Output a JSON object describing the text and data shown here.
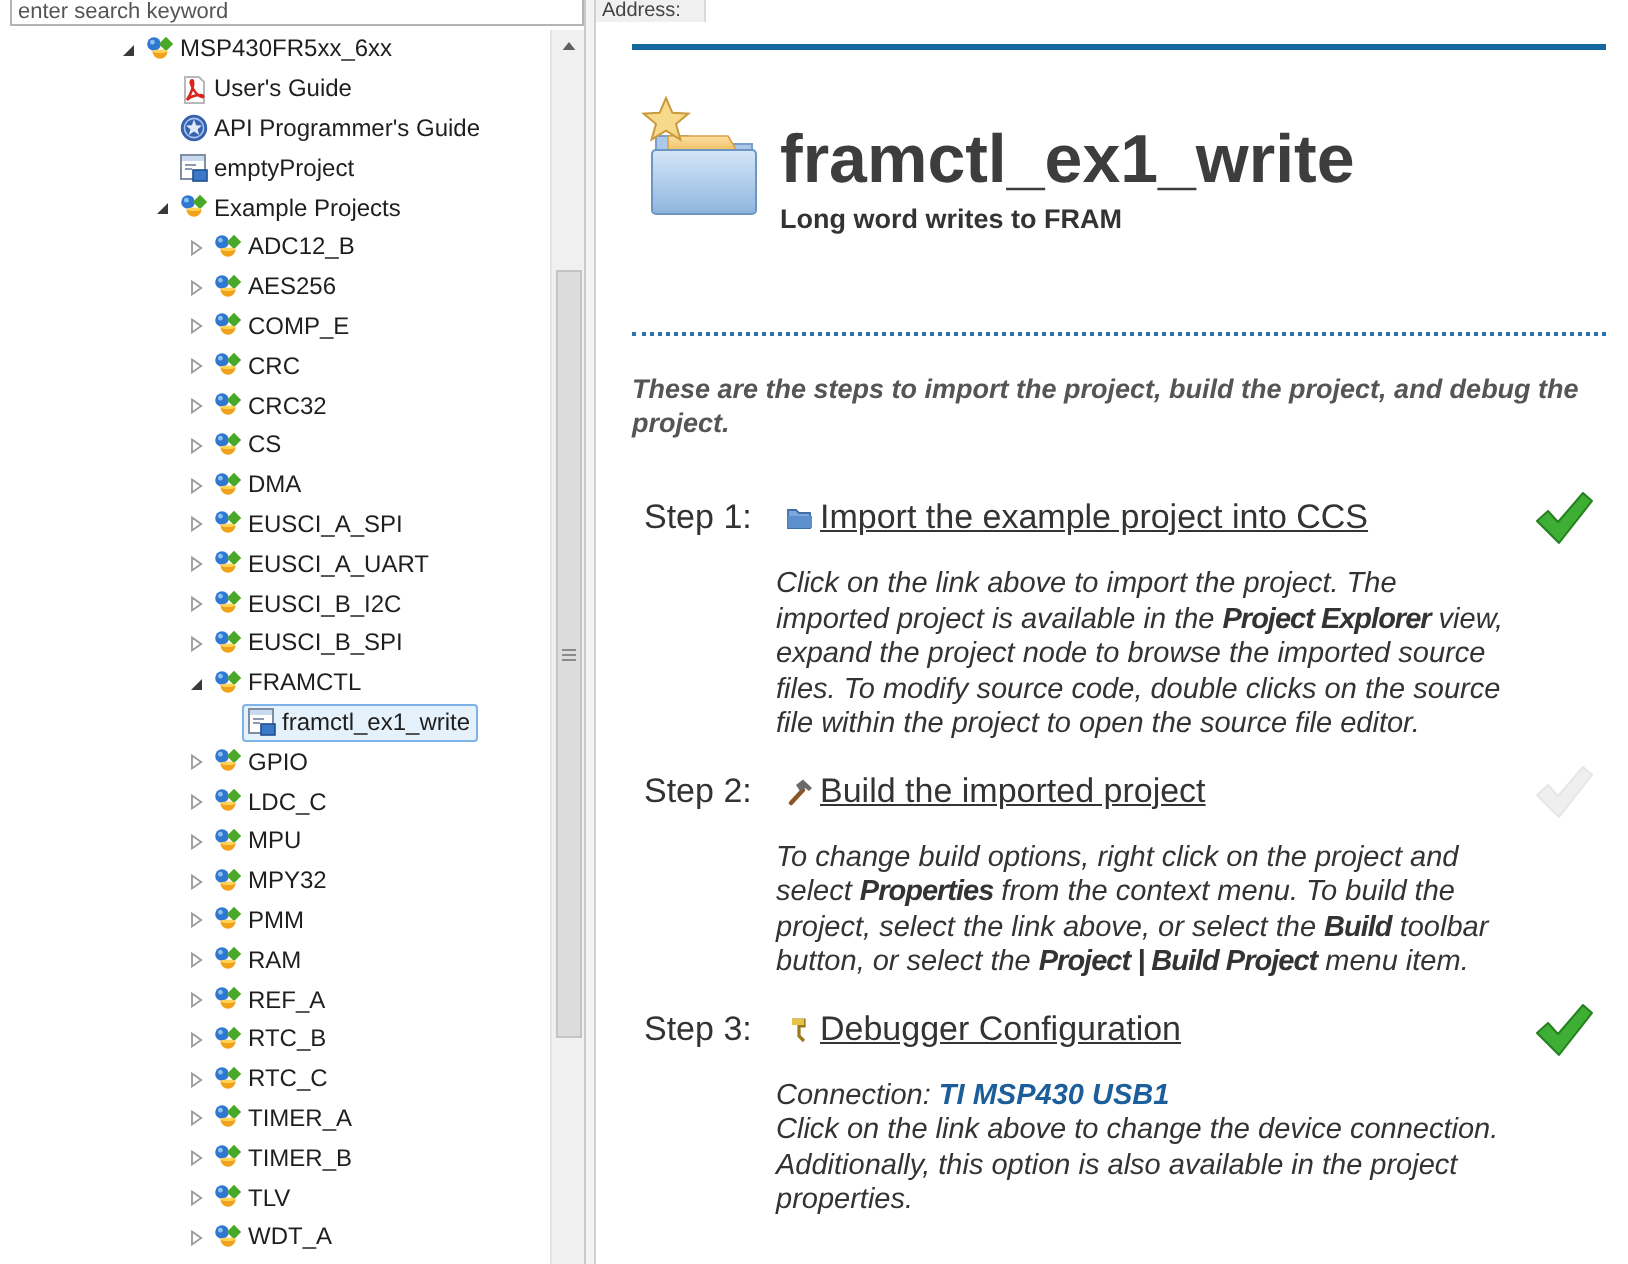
{
  "search": {
    "placeholder": "enter search keyword"
  },
  "tree": {
    "items": [
      {
        "label": "MSP430FR5xx_6xx",
        "kind": "package",
        "expanded": true,
        "selected": false,
        "children": [
          {
            "label": "User's Guide",
            "kind": "pdf",
            "selected": false
          },
          {
            "label": "API Programmer's Guide",
            "kind": "api",
            "selected": false
          },
          {
            "label": "emptyProject",
            "kind": "project",
            "selected": false
          },
          {
            "label": "Example Projects",
            "kind": "package",
            "expanded": true,
            "selected": false,
            "children": [
              {
                "label": "ADC12_B",
                "kind": "package",
                "expanded": false,
                "selected": false
              },
              {
                "label": "AES256",
                "kind": "package",
                "expanded": false,
                "selected": false
              },
              {
                "label": "COMP_E",
                "kind": "package",
                "expanded": false,
                "selected": false
              },
              {
                "label": "CRC",
                "kind": "package",
                "expanded": false,
                "selected": false
              },
              {
                "label": "CRC32",
                "kind": "package",
                "expanded": false,
                "selected": false
              },
              {
                "label": "CS",
                "kind": "package",
                "expanded": false,
                "selected": false
              },
              {
                "label": "DMA",
                "kind": "package",
                "expanded": false,
                "selected": false
              },
              {
                "label": "EUSCI_A_SPI",
                "kind": "package",
                "expanded": false,
                "selected": false
              },
              {
                "label": "EUSCI_A_UART",
                "kind": "package",
                "expanded": false,
                "selected": false
              },
              {
                "label": "EUSCI_B_I2C",
                "kind": "package",
                "expanded": false,
                "selected": false
              },
              {
                "label": "EUSCI_B_SPI",
                "kind": "package",
                "expanded": false,
                "selected": false
              },
              {
                "label": "FRAMCTL",
                "kind": "package",
                "expanded": true,
                "selected": false,
                "children": [
                  {
                    "label": "framctl_ex1_write",
                    "kind": "project",
                    "selected": true
                  }
                ]
              },
              {
                "label": "GPIO",
                "kind": "package",
                "expanded": false,
                "selected": false
              },
              {
                "label": "LDC_C",
                "kind": "package",
                "expanded": false,
                "selected": false
              },
              {
                "label": "MPU",
                "kind": "package",
                "expanded": false,
                "selected": false
              },
              {
                "label": "MPY32",
                "kind": "package",
                "expanded": false,
                "selected": false
              },
              {
                "label": "PMM",
                "kind": "package",
                "expanded": false,
                "selected": false
              },
              {
                "label": "RAM",
                "kind": "package",
                "expanded": false,
                "selected": false
              },
              {
                "label": "REF_A",
                "kind": "package",
                "expanded": false,
                "selected": false
              },
              {
                "label": "RTC_B",
                "kind": "package",
                "expanded": false,
                "selected": false
              },
              {
                "label": "RTC_C",
                "kind": "package",
                "expanded": false,
                "selected": false
              },
              {
                "label": "TIMER_A",
                "kind": "package",
                "expanded": false,
                "selected": false
              },
              {
                "label": "TIMER_B",
                "kind": "package",
                "expanded": false,
                "selected": false
              },
              {
                "label": "TLV",
                "kind": "package",
                "expanded": false,
                "selected": false
              },
              {
                "label": "WDT_A",
                "kind": "package",
                "expanded": false,
                "selected": false
              }
            ]
          }
        ]
      }
    ]
  },
  "address": {
    "label": "Address:"
  },
  "page": {
    "title": "framctl_ex1_write",
    "subtitle": "Long word writes to FRAM",
    "intro": "These are the steps to import the project, build the project, and debug the project.",
    "steps": [
      {
        "label": "Step 1:",
        "kind": "import",
        "link": "Import the example project into CCS",
        "done": true,
        "description": "Click on the link above to import the project. The imported project is available in the **Project Explorer** view, expand the project node to browse the imported source files. To modify source code, double clicks on the source file within the project to open the source file editor."
      },
      {
        "label": "Step 2:",
        "kind": "build",
        "link": "Build the imported project",
        "done": false,
        "description": "To change build options, right click on the project and select **Properties** from the context menu. To build the project, select the link above, or select the **Build** toolbar button, or select the **Project | Build Project** menu item."
      },
      {
        "label": "Step 3:",
        "kind": "debug",
        "link": "Debugger Configuration",
        "done": true,
        "connection": {
          "label": "Connection:",
          "link": "TI MSP430 USB1"
        },
        "description": "Click on the link above to change the device connection. Additionally, this option is also available in the project properties."
      }
    ]
  }
}
